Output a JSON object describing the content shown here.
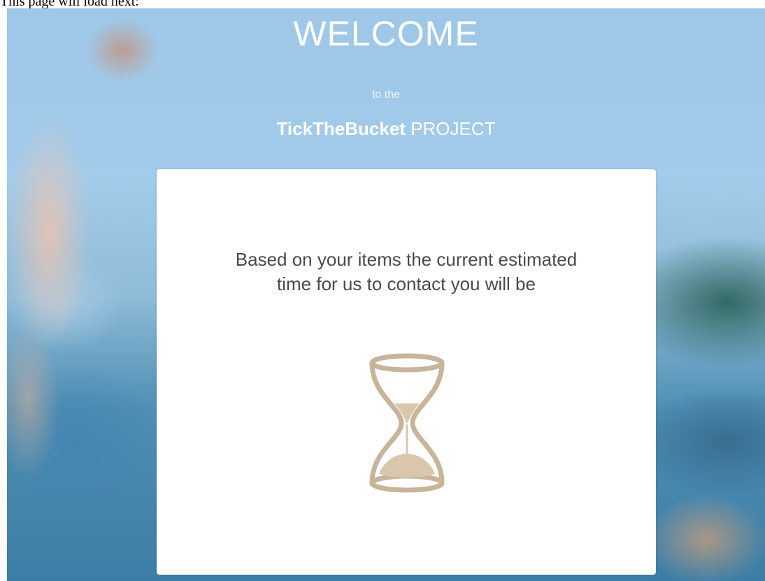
{
  "page_note": "This page will load next:",
  "header": {
    "welcome": "WELCOME",
    "to_the": "to the",
    "brand": "TickTheBucket",
    "project": "PROJECT"
  },
  "card": {
    "line1": "Based on your items the current estimated",
    "line2": "time for us to contact you will be",
    "icon": "hourglass-icon"
  },
  "colors": {
    "icon": "#c8b49a",
    "card_text": "#4a4a4a",
    "sky": "#a3cbea"
  }
}
